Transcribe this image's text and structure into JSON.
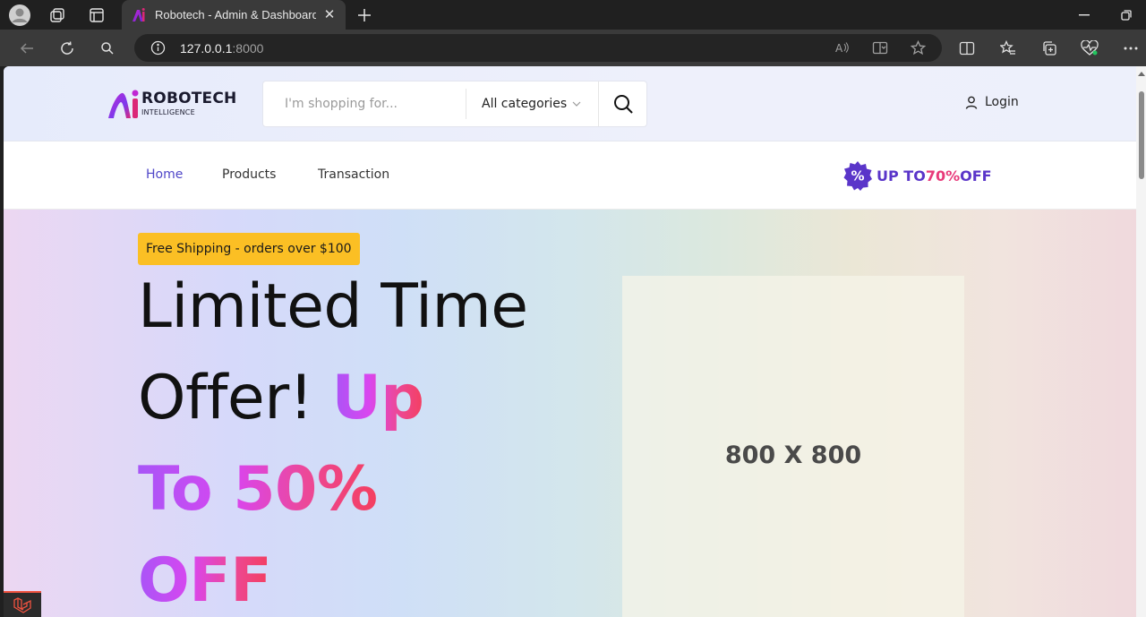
{
  "browser": {
    "tab_title": "Robotech - Admin & Dashboard",
    "url_host": "127.0.0.1",
    "url_port": ":8000",
    "close_glyph": "✕",
    "new_tab_glyph": "+"
  },
  "site": {
    "logo_name": "ROBOTECH",
    "logo_sub": "INTELLIGENCE",
    "search_placeholder": "I'm shopping for...",
    "category_label": "All categories",
    "login_label": "Login"
  },
  "nav": {
    "items": [
      {
        "label": "Home",
        "active": true
      },
      {
        "label": "Products",
        "active": false
      },
      {
        "label": "Transaction",
        "active": false
      }
    ],
    "promo_prefix": "UP TO",
    "promo_value": "70%",
    "promo_suffix": "OFF",
    "promo_badge_symbol": "%"
  },
  "hero": {
    "badge": "Free Shipping - orders over $100",
    "line1": "Limited Time",
    "line2": "Offer!",
    "highlight_1": "Up",
    "highlight_2": "To 50%",
    "highlight_3": "OFF",
    "placeholder_label": "800 X 800"
  },
  "colors": {
    "accent_purple": "#4f46c8",
    "promo_pink": "#e83a7a",
    "badge_yellow": "#fbbf24"
  }
}
